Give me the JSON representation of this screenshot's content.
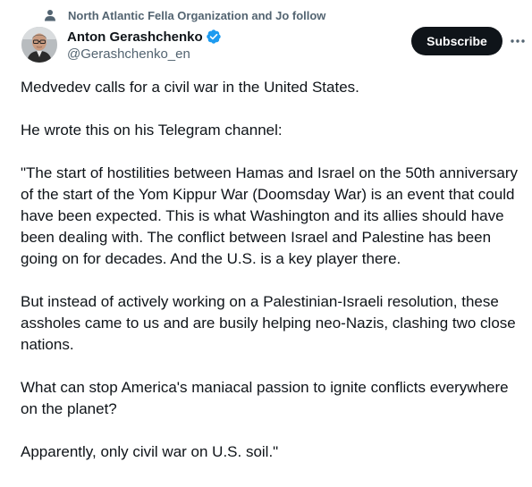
{
  "social_context": {
    "text": "North Atlantic Fella Organization and Jo follow",
    "icon": "person-icon"
  },
  "author": {
    "display_name": "Anton Gerashchenko",
    "handle": "@Gerashchenko_en",
    "verified": true,
    "verified_color": "#1d9bf0"
  },
  "actions": {
    "subscribe_label": "Subscribe",
    "more_icon": "more-horizontal-icon"
  },
  "tweet": {
    "paragraphs": [
      "Medvedev calls for a civil war in the United States.",
      "He wrote this on his Telegram channel:",
      "\"The start of hostilities between Hamas and Israel on the 50th anniversary of the start of the Yom Kippur War (Doomsday War) is an event that could have been expected. This is what Washington and its allies should have been dealing with. The conflict between Israel and Palestine has been going on for decades. And the U.S. is a key player there.",
      "But instead of actively working on a Palestinian-Israeli resolution, these assholes came to us and are busily helping neo-Nazis, clashing two close nations.",
      "What can stop America's maniacal passion to ignite conflicts everywhere on the planet?",
      "Apparently, only civil war on U.S. soil.\""
    ]
  },
  "colors": {
    "text_primary": "#0f1419",
    "text_secondary": "#536471",
    "button_bg": "#0f1419",
    "button_text": "#ffffff",
    "accent": "#1d9bf0"
  }
}
